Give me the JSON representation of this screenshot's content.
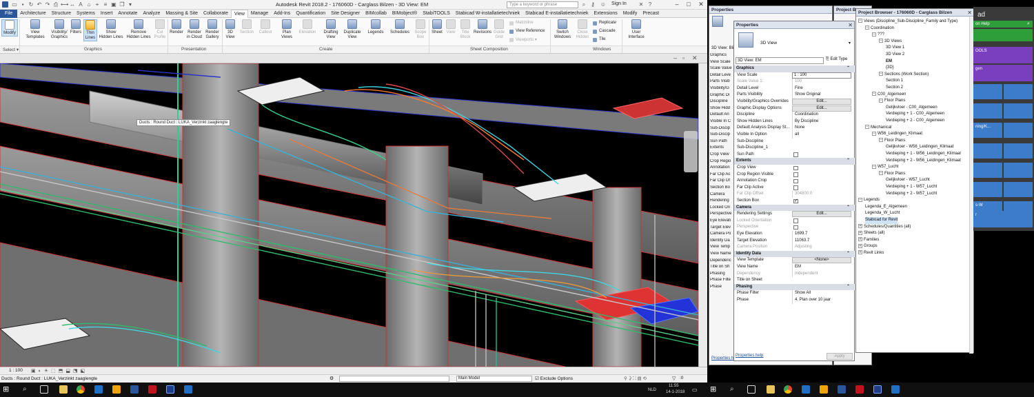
{
  "app": {
    "title": "Autodesk Revit 2018.2 -   176060D - Carglass Bilzen - 3D View: EM",
    "search_placeholder": "Type a keyword or phrase",
    "signin": "Sign In"
  },
  "tabs": [
    "File",
    "Architecture",
    "Structure",
    "Systems",
    "Insert",
    "Annotate",
    "Analyze",
    "Massing & Site",
    "Collaborate",
    "View",
    "Manage",
    "Add-Ins",
    "Quantification",
    "Site Designer",
    "BIMcollab",
    "BIMobject®",
    "StabiTOOLS",
    "Stabicad W-installatietechniek",
    "Stabicad E-installatietechniek",
    "Extensions",
    "Modify",
    "Precast"
  ],
  "active_tab": "View",
  "ribbon": {
    "modify": "Modify",
    "select": "Select ▾",
    "graphics_buttons": [
      "View\nTemplates",
      "Visibility/\nGraphics",
      "Filters",
      "Thin\nLines",
      "Show\nHidden Lines",
      "Remove\nHidden Lines",
      "Cut\nProfile"
    ],
    "presentation_buttons": [
      "Render",
      "Render\nin Cloud",
      "Render\nGallery"
    ],
    "create_buttons": [
      "3D\nView",
      "Section",
      "Callout",
      "Plan\nViews",
      "Elevation",
      "Drafting\nView",
      "Duplicate\nView",
      "Legends",
      "Schedules",
      "Scope\nBox"
    ],
    "sheet_buttons": [
      "Sheet",
      "View",
      "Title\nBlock",
      "Revisions",
      "Guide\nGrid"
    ],
    "sheet_small": [
      "Matchline",
      "View Reference",
      "Viewports ▾"
    ],
    "windows_buttons": [
      "Switch\nWindows",
      "Close\nHidden",
      "Tile"
    ],
    "windows_small": [
      "Replicate",
      "Cascade"
    ],
    "ui_button": "User\nInterface",
    "panels": [
      "Graphics",
      "Presentation",
      "Create",
      "Sheet Composition",
      "Windows"
    ]
  },
  "viewport": {
    "tooltip": "Ducts : Round Duct : LUKA_Verzinkt zaaglengte",
    "scale": "1 : 100"
  },
  "statusbar": {
    "text": "Ducts : Round Duct : LUKA_Verzinkt zaaglengte",
    "model": "Main Model",
    "exclude": "Exclude Options",
    "zero": ":0"
  },
  "taskbar1": {
    "time": "11:55",
    "date": "14-1-2018",
    "lang": "NLD"
  },
  "properties_small": {
    "title": "Properties",
    "type": "3D View: Bli",
    "rows": [
      "Graphics",
      "View Scale",
      "Scale Value",
      "Detail Leve",
      "Parts Visib",
      "Visibility/G",
      "Graphic Di",
      "Discipline",
      "Show Hidd",
      "Default An",
      "Visible In C",
      "Sub-Discip",
      "Sub-Discip",
      "Sun Path",
      "Extents",
      "Crop View",
      "Crop Regio",
      "Annotation",
      "Far Clip Ac",
      "Far Clip Of",
      "Section Bo",
      "Camera",
      "Rendering",
      "Locked Ori",
      "Perspective",
      "Eye Elevati",
      "Target Elev",
      "Camera Po",
      "Identity Da",
      "View Temp",
      "View Name",
      "Dependenc",
      "Title on Sh",
      "Phasing",
      "Phase Filte",
      "Phase"
    ],
    "help": "Properties h"
  },
  "properties": {
    "title": "Properties",
    "type_name": "3D View",
    "selector": "3D View: EM",
    "edit_type": "Edit Type",
    "help": "Properties help",
    "apply": "Apply",
    "rows": [
      {
        "g": "Graphics"
      },
      {
        "k": "View Scale",
        "v": "1 : 100",
        "t": "num"
      },
      {
        "k": "Scale Value    1:",
        "v": "100",
        "d": 1
      },
      {
        "k": "Detail Level",
        "v": "Fine"
      },
      {
        "k": "Parts Visibility",
        "v": "Show Original"
      },
      {
        "k": "Visibility/Graphics Overrides",
        "v": "Edit...",
        "t": "btn"
      },
      {
        "k": "Graphic Display Options",
        "v": "Edit...",
        "t": "btn"
      },
      {
        "k": "Discipline",
        "v": "Coordination"
      },
      {
        "k": "Show Hidden Lines",
        "v": "By Discipline"
      },
      {
        "k": "Default Analysis Display St...",
        "v": "None"
      },
      {
        "k": "Visible In Option",
        "v": "all"
      },
      {
        "k": "Sub-Discipline",
        "v": ""
      },
      {
        "k": "Sub-Discipline_1",
        "v": ""
      },
      {
        "k": "Sun Path",
        "v": "",
        "t": "chk"
      },
      {
        "g": "Extents"
      },
      {
        "k": "Crop View",
        "v": "",
        "t": "chk"
      },
      {
        "k": "Crop Region Visible",
        "v": "",
        "t": "chk"
      },
      {
        "k": "Annotation Crop",
        "v": "",
        "t": "chk"
      },
      {
        "k": "Far Clip Active",
        "v": "",
        "t": "chk"
      },
      {
        "k": "Far Clip Offset",
        "v": "304800.0",
        "d": 1
      },
      {
        "k": "Section Box",
        "v": "",
        "t": "chkon"
      },
      {
        "g": "Camera"
      },
      {
        "k": "Rendering Settings",
        "v": "Edit...",
        "t": "btn"
      },
      {
        "k": "Locked Orientation",
        "v": "",
        "t": "chk",
        "d": 1
      },
      {
        "k": "Perspective",
        "v": "",
        "t": "chk",
        "d": 1
      },
      {
        "k": "Eye Elevation",
        "v": "1699.7"
      },
      {
        "k": "Target Elevation",
        "v": "11063.7"
      },
      {
        "k": "Camera Position",
        "v": "Adjusting",
        "d": 1
      },
      {
        "g": "Identity Data"
      },
      {
        "k": "View Template",
        "v": "<None>",
        "t": "btn"
      },
      {
        "k": "View Name",
        "v": "EM"
      },
      {
        "k": "Dependency",
        "v": "Independent",
        "d": 1
      },
      {
        "k": "Title on Sheet",
        "v": ""
      },
      {
        "g": "Phasing"
      },
      {
        "k": "Phase Filter",
        "v": "Show All"
      },
      {
        "k": "Phase",
        "v": "4. Plan over 10 jaar"
      }
    ]
  },
  "project_browser_back": {
    "title": "Project Bro"
  },
  "project_browser": {
    "title": "Project Browser - 176060D - Carglass Bilzen",
    "nodes": [
      {
        "l": "Views (Discipline_Sub-Discipline_Family and Type)",
        "d": 0
      },
      {
        "l": "Coordination",
        "d": 1
      },
      {
        "l": "???",
        "d": 2
      },
      {
        "l": "3D Views",
        "d": 3
      },
      {
        "l": "3D View 1",
        "d": 4
      },
      {
        "l": "3D View 2",
        "d": 4
      },
      {
        "l": "EM",
        "d": 4,
        "b": 1
      },
      {
        "l": "{3D}",
        "d": 4
      },
      {
        "l": "Sections (Work Section)",
        "d": 3
      },
      {
        "l": "Section 1",
        "d": 4
      },
      {
        "l": "Section 2",
        "d": 4
      },
      {
        "l": "C00_Algemeen",
        "d": 2
      },
      {
        "l": "Floor Plans",
        "d": 3
      },
      {
        "l": "Gelijkvloer - C00_Algemeen",
        "d": 4
      },
      {
        "l": "Verdieping + 1 - C00_Algemeen",
        "d": 4
      },
      {
        "l": "Verdieping + 2 - C00_Algemeen",
        "d": 4
      },
      {
        "l": "Mechanical",
        "d": 1
      },
      {
        "l": "W56_Leidingen_Klimaat",
        "d": 2
      },
      {
        "l": "Floor Plans",
        "d": 3
      },
      {
        "l": "Gelijkvloer - W56_Leidingen_Klimaat",
        "d": 4
      },
      {
        "l": "Verdieping + 1 - W56_Leidingen_Klimaat",
        "d": 4
      },
      {
        "l": "Verdieping + 2 - W56_Leidingen_Klimaat",
        "d": 4
      },
      {
        "l": "W57_Lucht",
        "d": 2
      },
      {
        "l": "Floor Plans",
        "d": 3
      },
      {
        "l": "Gelijkvloer - W57_Lucht",
        "d": 4
      },
      {
        "l": "Verdieping + 1 - W57_Lucht",
        "d": 4
      },
      {
        "l": "Verdieping + 2 - W57_Lucht",
        "d": 4
      },
      {
        "l": "Legends",
        "d": 0
      },
      {
        "l": "Legenda_E_Algemeen",
        "d": 1
      },
      {
        "l": "Legenda_W_Lucht",
        "d": 1
      },
      {
        "l": "Stabicad for Revit",
        "d": 1,
        "h": 1
      },
      {
        "l": "Schedules/Quantities (all)",
        "d": 0
      },
      {
        "l": "Sheets (all)",
        "d": 0
      },
      {
        "l": "Families",
        "d": 0
      },
      {
        "l": "Groups",
        "d": 0
      },
      {
        "l": "Revit Links",
        "d": 0
      }
    ]
  },
  "dynamo": {
    "title": "ad",
    "search": "on Help",
    "tools": "OOLS",
    "gen": "gen",
    "ning": "ning/K...",
    "w": "s-W",
    "r": "r"
  },
  "colors": {
    "file_tab": "#2b579a",
    "dynamo_green": "#2e9e3a",
    "dynamo_purple": "#7a3fbf",
    "dynamo_blue": "#3d7cc9"
  }
}
